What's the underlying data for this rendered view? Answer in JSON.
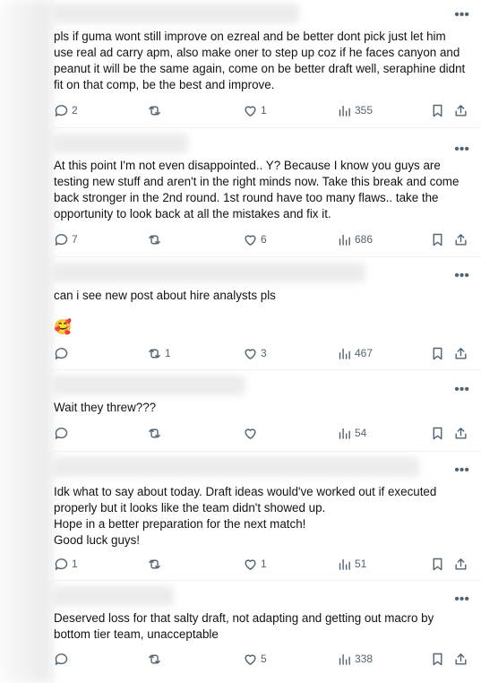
{
  "icons": {
    "reply": "reply-icon",
    "retweet": "retweet-icon",
    "like": "heart-icon",
    "views": "views-icon",
    "bookmark": "bookmark-icon",
    "share": "share-icon",
    "more": "more-icon"
  },
  "more_label": "•••",
  "replies": [
    {
      "text": "pls if guma wont still improve on ezreal and be better dont pick just let him use real ad carry apm, also make oner to step up coz if he faces canyon and peanut it will be the same again, come on be better draft well, seraphine didnt fit on that comp, be the best and improve.",
      "replies": "2",
      "retweets": "",
      "likes": "1",
      "views": "355"
    },
    {
      "text": "At this point I'm not even disappointed.. Y? Because I know you guys are testing new stuff and aren't in the right minds now. Take this break and come back stronger in the 2nd round. 1st round have too many flaws.. take the opportunity to look back at all the mistakes and fix it.",
      "replies": "7",
      "retweets": "",
      "likes": "6",
      "views": "686"
    },
    {
      "text": "can i see new post about hire analysts pls",
      "emoji": "🥰",
      "replies": "",
      "retweets": "1",
      "likes": "3",
      "views": "467"
    },
    {
      "text": "Wait they threw???",
      "replies": "",
      "retweets": "",
      "likes": "",
      "views": "54"
    },
    {
      "text": "Idk what to say about today. Draft ideas would've worked out if executed properly but it looks like the team didn't showed up.\nHope in a better preparation for the next match!\nGood luck guys!",
      "replies": "1",
      "retweets": "",
      "likes": "1",
      "views": "51"
    },
    {
      "text": "Deserved loss for that salty draft, not adapting and getting out macro by bottom tier team, unacceptable",
      "replies": "",
      "retweets": "",
      "likes": "5",
      "views": "338"
    }
  ]
}
